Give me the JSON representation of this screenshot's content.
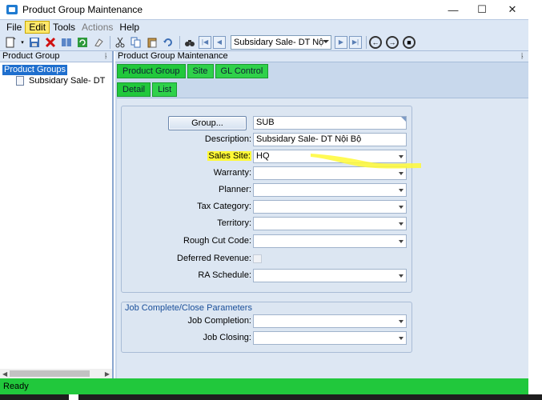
{
  "window": {
    "title": "Product Group Maintenance",
    "minimize": "—",
    "maximize": "☐",
    "close": "✕"
  },
  "menu": {
    "file": "File",
    "edit": "Edit",
    "tools": "Tools",
    "actions": "Actions",
    "help": "Help"
  },
  "toolbar": {
    "record_selector": "Subsidary Sale- DT Nộ"
  },
  "left_panel": {
    "title": "Product Group",
    "tree_root": "Product Groups",
    "tree_child": "Subsidary Sale- DT"
  },
  "right_panel": {
    "title": "Product Group Maintenance",
    "tabs": [
      "Product Group",
      "Site",
      "GL Control"
    ],
    "subtabs": [
      "Detail",
      "List"
    ]
  },
  "form": {
    "group_button": "Group...",
    "group_value": "SUB",
    "description_label": "Description:",
    "description_value": "Subsidary Sale- DT Nội Bộ",
    "sales_site_label": "Sales Site:",
    "sales_site_value": "HQ",
    "warranty_label": "Warranty:",
    "planner_label": "Planner:",
    "tax_category_label": "Tax Category:",
    "territory_label": "Territory:",
    "rough_cut_label": "Rough Cut Code:",
    "deferred_revenue_label": "Deferred Revenue:",
    "ra_schedule_label": "RA Schedule:"
  },
  "job_params": {
    "title": "Job Complete/Close Parameters",
    "completion_label": "Job Completion:",
    "closing_label": "Job Closing:"
  },
  "status": {
    "text": "Ready"
  },
  "colors": {
    "highlight": "#fff936",
    "tab_green": "#21c83c",
    "selection_blue": "#1f6fce"
  }
}
